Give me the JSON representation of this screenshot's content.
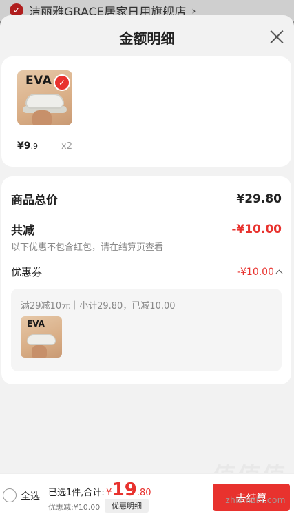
{
  "store": {
    "name": "洁丽雅GRACE居家日用旗舰店",
    "chevron": "›"
  },
  "sheet": {
    "title": "金额明细"
  },
  "product": {
    "thumb_text": "EVA",
    "price_int": "¥9",
    "price_dec": ".9",
    "qty": "x2"
  },
  "summary": {
    "total_label": "商品总价",
    "total_value": "¥29.80",
    "reduce_label": "共减",
    "reduce_value": "-¥10.00",
    "note": "以下优惠不包含红包，请在结算页查看",
    "coupon_label": "优惠券",
    "coupon_value": "-¥10.00"
  },
  "coupon": {
    "desc": "满29减10元｜小计29.80，已减10.00",
    "thumb_text": "EVA"
  },
  "bottom": {
    "select_all": "全选",
    "selected": "已选1件,合计:",
    "yen": "¥",
    "total_int": "19",
    "total_dec": ".80",
    "discount": "优惠减:¥10.00",
    "detail_btn": "优惠明细",
    "checkout": "去结算"
  },
  "watermark": {
    "logo": "值值值",
    "text": "zhizhizhi.com"
  },
  "colors": {
    "accent": "#e8322e",
    "sheet_bg": "#f2f2f2"
  },
  "icons": [
    "check-icon",
    "close-icon",
    "chevron-up-icon",
    "radio-icon"
  ]
}
